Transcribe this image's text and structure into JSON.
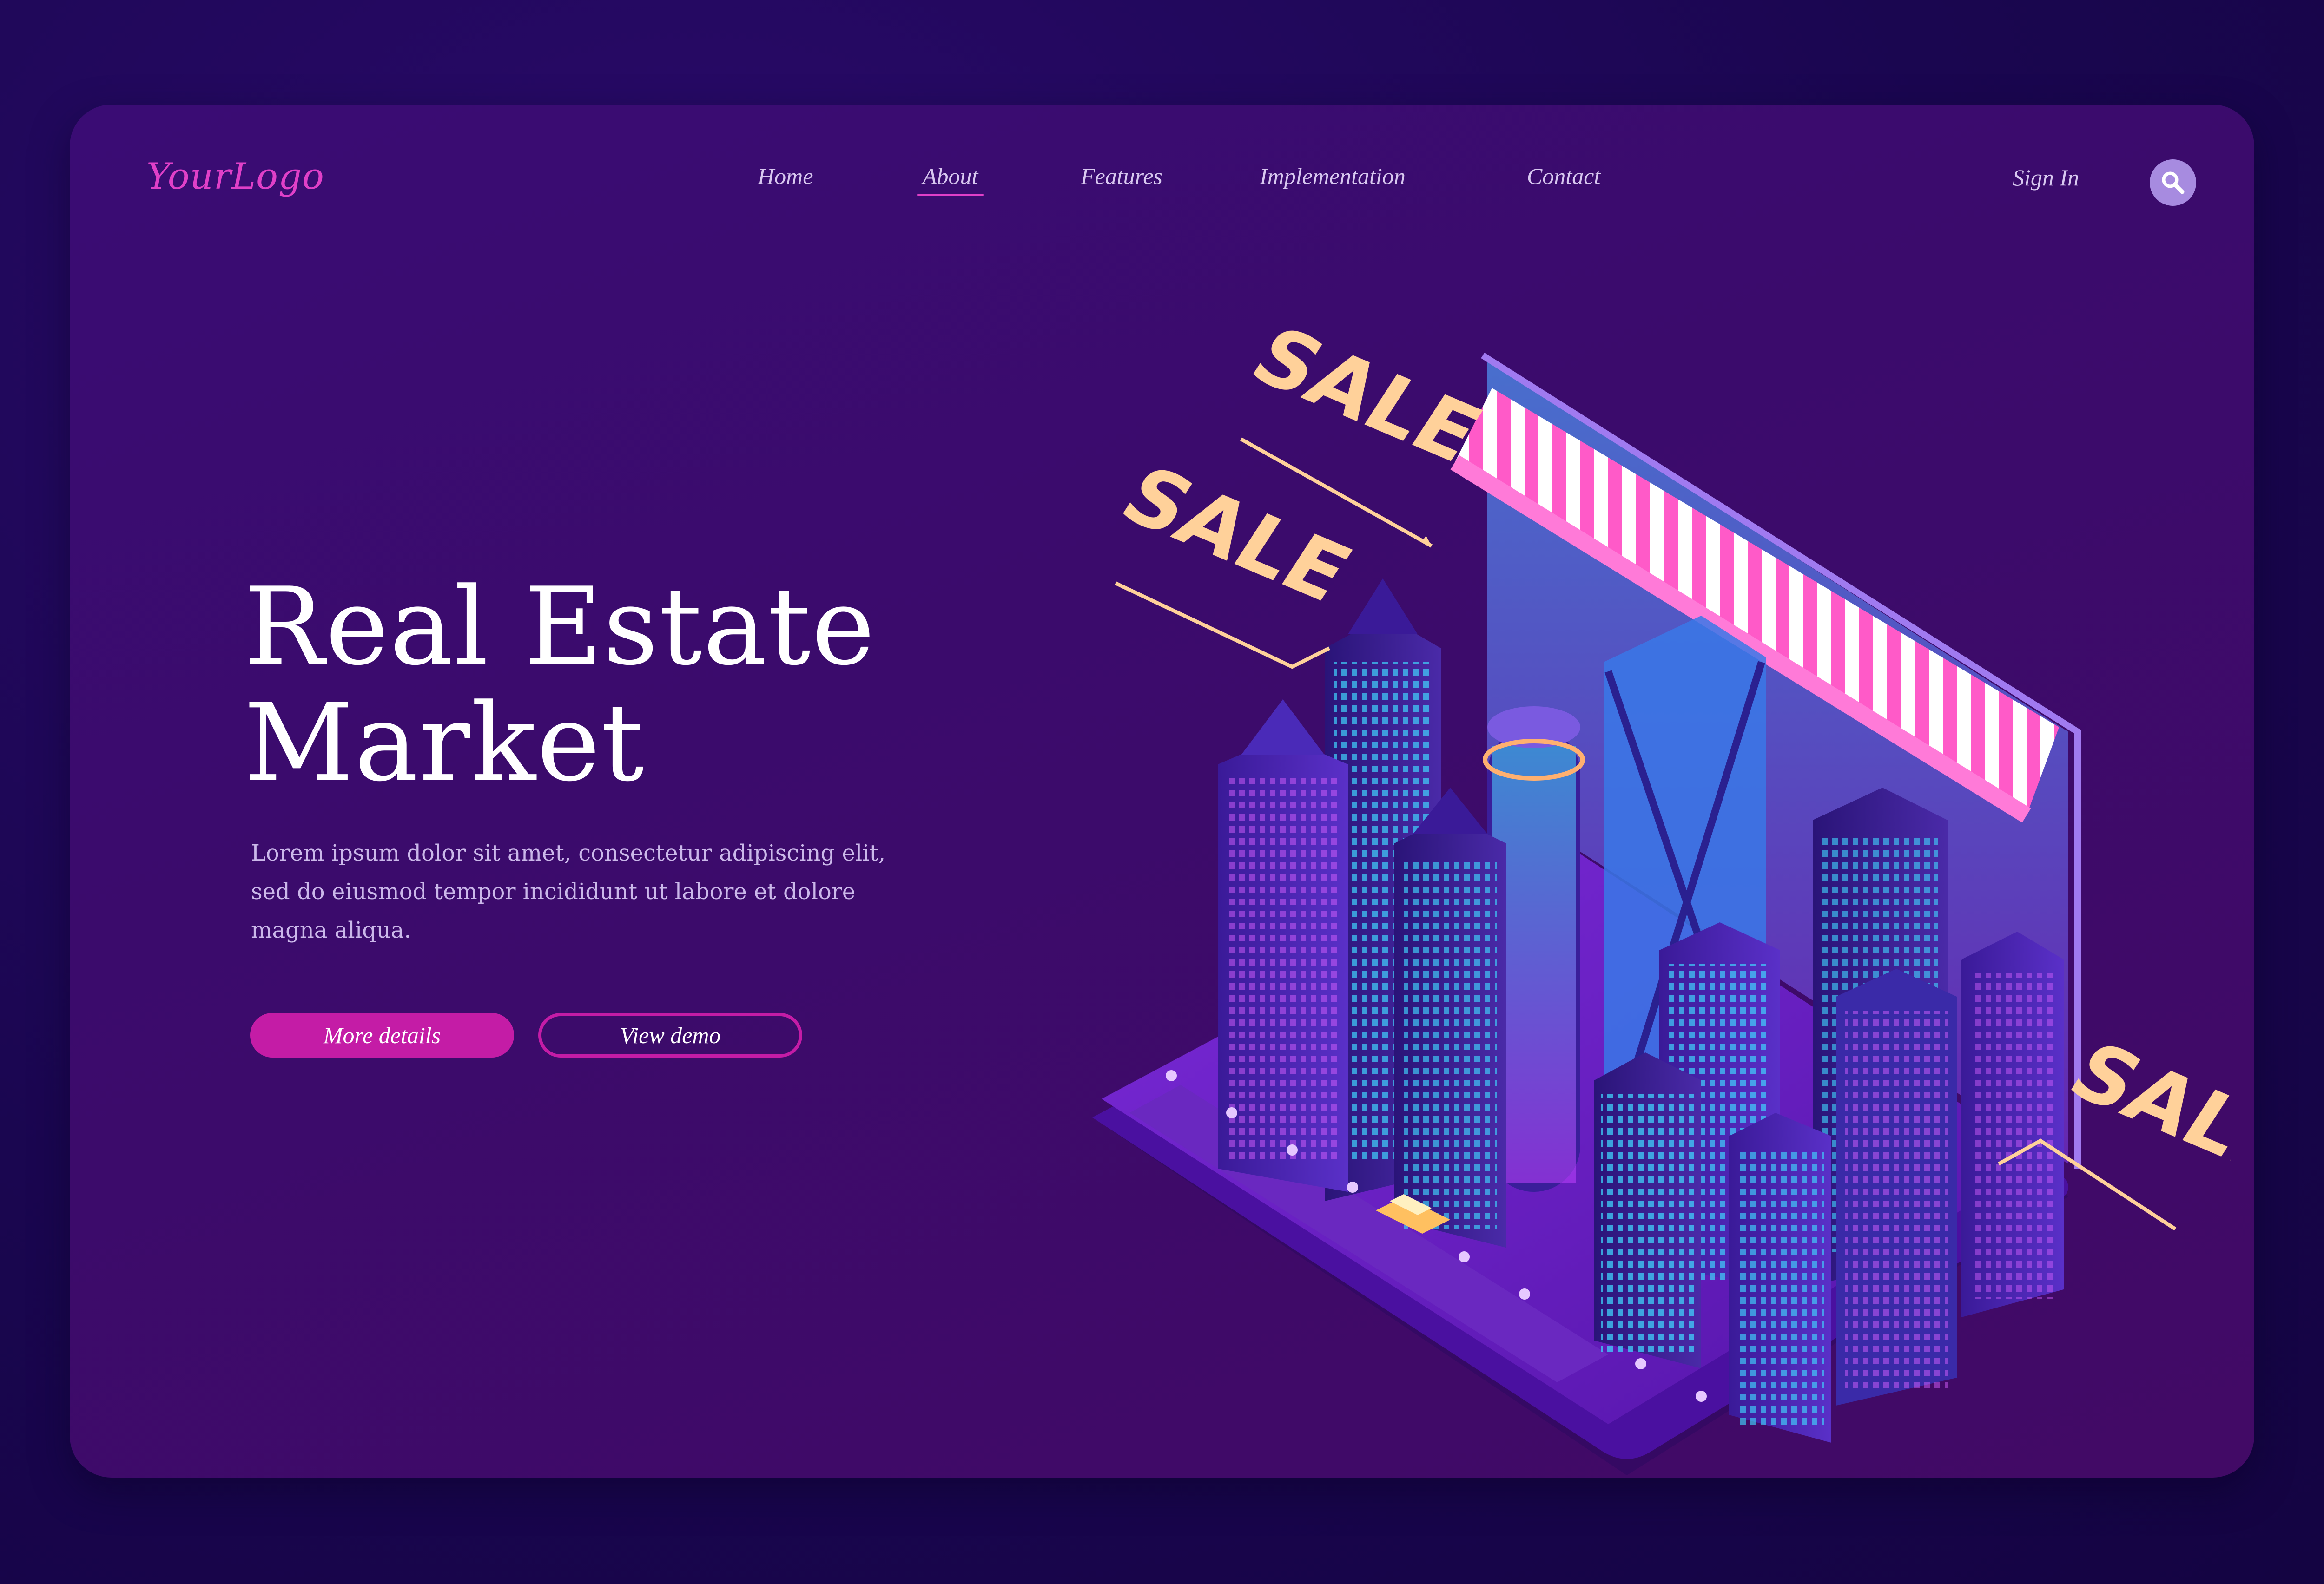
{
  "header": {
    "logo": "YourLogo",
    "nav": [
      {
        "label": "Home",
        "active": false
      },
      {
        "label": "About",
        "active": true
      },
      {
        "label": "Features",
        "active": false
      },
      {
        "label": "Implementation",
        "active": false
      },
      {
        "label": "Contact",
        "active": false
      }
    ],
    "sign_in": "Sign In",
    "search_icon": "search-icon"
  },
  "hero": {
    "title_line1": "Real Estate",
    "title_line2": "Market",
    "description": "Lorem ipsum dolor sit amet, consectetur adipiscing elit, sed do eiusmod tempor incididunt ut labore et dolore magna aliqua.",
    "primary_button": "More details",
    "secondary_button": "View demo"
  },
  "illustration": {
    "sale_labels": [
      "SALE",
      "SALE",
      "SALE"
    ],
    "accent_color": "#e040c8",
    "neon_color": "#38e8ff",
    "label_color": "#ffd19a"
  }
}
